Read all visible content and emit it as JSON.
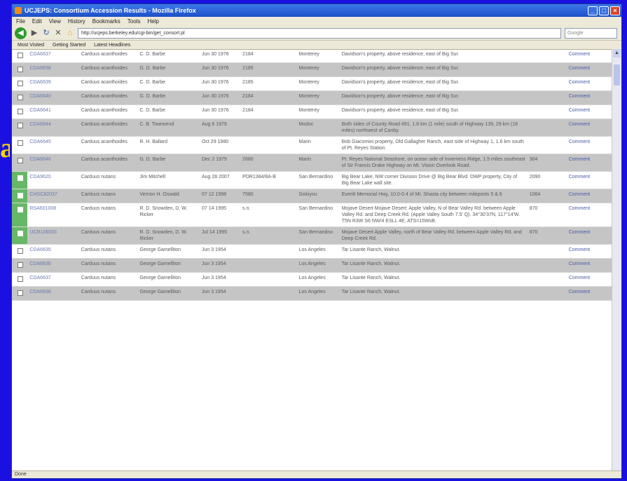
{
  "window": {
    "title": "UCJEPS: Consortium Accession Results - Mozilla Firefox"
  },
  "menu": [
    "File",
    "Edit",
    "View",
    "History",
    "Bookmarks",
    "Tools",
    "Help"
  ],
  "address": {
    "url": "http://ucjeps.berkeley.edu/cgi-bin/get_consort.pl"
  },
  "search": {
    "placeholder": "Google"
  },
  "bookmarks": [
    "Most Visited",
    "Getting Started",
    "Latest Headlines"
  ],
  "rows": [
    {
      "acc": "CDA6637",
      "taxon": "Carduus acanthoides",
      "coll": "C. D. Barbe",
      "date": "Jun 30 1976",
      "num": "2184",
      "county": "Monterey",
      "loc": "Davidson's property, above residence, east of Big Sur.",
      "elev": "",
      "sel": false,
      "alt": false
    },
    {
      "acc": "CDA6638",
      "taxon": "Carduus acanthoides",
      "coll": "G. D. Barbe",
      "date": "Jun 30 1976",
      "num": "2185",
      "county": "Monterey",
      "loc": "Davidson's property, above residence, east of Big Sur.",
      "elev": "",
      "sel": false,
      "alt": true
    },
    {
      "acc": "CDA6639",
      "taxon": "Carduus acanthoides",
      "coll": "C. D. Barbe",
      "date": "Jun 30 1976",
      "num": "2185",
      "county": "Monterey",
      "loc": "Davidson's property, above residence, east of Big Sur.",
      "elev": "",
      "sel": false,
      "alt": false
    },
    {
      "acc": "CDA6640",
      "taxon": "Carduus acanthoides",
      "coll": "G. D. Barbe",
      "date": "Jun 30 1976",
      "num": "2184",
      "county": "Monterey",
      "loc": "Davidson's property, above residence, east of Big Sur.",
      "elev": "",
      "sel": false,
      "alt": true
    },
    {
      "acc": "CDA6641",
      "taxon": "Carduus acanthoides",
      "coll": "C. D. Barbe",
      "date": "Jun 30 1976",
      "num": "2184",
      "county": "Monterey",
      "loc": "Davidson's property, above residence, east of Big Sur.",
      "elev": "",
      "sel": false,
      "alt": false
    },
    {
      "acc": "CDA6644",
      "taxon": "Carduus acanthoides",
      "coll": "C. B. Townsend",
      "date": "Aug 6 1979",
      "num": "",
      "county": "Modoc",
      "loc": "Both sides of County Road #91, 1.6 km (1 mile) south of Highway 139, 29 km (18 miles) northwest of Canby.",
      "elev": "",
      "sel": false,
      "alt": true
    },
    {
      "acc": "CDA6645",
      "taxon": "Carduus acanthoides",
      "coll": "R. H. Ballard",
      "date": "Oct 29 1980",
      "num": "",
      "county": "Marin",
      "loc": "Bob Giacomini property, Old Gallagher Ranch, east side of Highway 1, 1.6 km south of Pt. Reyes Station.",
      "elev": "",
      "sel": false,
      "alt": false
    },
    {
      "acc": "CDA6646",
      "taxon": "Carduus acanthoides",
      "coll": "G. D. Barbe",
      "date": "Dec 2 1979",
      "num": "2680",
      "county": "Marin",
      "loc": "Pt. Reyes National Seashore, on ocean side of Inverness Ridge, 1.5 miles southeast of Sir Francis Drake Highway on Mt. Vision Overlook Road.",
      "elev": "304",
      "sel": false,
      "alt": true
    },
    {
      "acc": "CDA9620",
      "taxon": "Carduus nutans",
      "coll": "Jim Mitchell",
      "date": "Aug 28 2007",
      "num": "PDR1384/8A-B",
      "county": "San Bernardino",
      "loc": "Big Bear Lake, NW corner Division Drive @ Big Bear Blvd. DWP property, City of Big Bear Lake wall site.",
      "elev": "2090",
      "sel": true,
      "alt": false
    },
    {
      "acc": "CHSC82037",
      "taxon": "Carduus nutans",
      "coll": "Vernon H. Oswald",
      "date": "07 12 1998",
      "num": "7580",
      "county": "Siskiyou",
      "loc": "Everitt Memorial Hwy, 10.0-0.4 of Mt. Shasta city between mileposts 5 & 6",
      "elev": "1064",
      "sel": true,
      "alt": true
    },
    {
      "acc": "RSA601008",
      "taxon": "Carduus nutans",
      "coll": "R. D. Snowden, D. W. Ricker",
      "date": "07 14 1995",
      "num": "s.n.",
      "county": "San Bernardino",
      "loc": "Mojave Desert Mojave Desert: Apple Valley, N of Bear Valley Rd. between Apple Valley Rd. and Deep Creek Rd. (Apple Valley South 7.5' Q). 34°30'37N, 117°14'W. T5N R3W S6 NW/4 ESLL 4E, ATS=15WsB.",
      "elev": "870",
      "sel": true,
      "alt": false
    },
    {
      "acc": "UCR106033",
      "taxon": "Carduus nutans",
      "coll": "R. D. Snowden, D. W. Ricker",
      "date": "Jul 14 1995",
      "num": "s.n.",
      "county": "San Bernardino",
      "loc": "Mojave Desert Apple Valley, north of Bear Valley Rd. between Apple Valley Rd. and Deep Creek Rd.",
      "elev": "870",
      "sel": true,
      "alt": true
    },
    {
      "acc": "CDA6635",
      "taxon": "Carduus nutans",
      "coll": "George Gamelliton",
      "date": "Jun 3 1954",
      "num": "",
      "county": "Los Angeles",
      "loc": "Tar Lisante Ranch, Walnut.",
      "elev": "",
      "sel": false,
      "alt": false
    },
    {
      "acc": "CDA6636",
      "taxon": "Carduus nutans",
      "coll": "George Gamelliton",
      "date": "Jun 3 1954",
      "num": "",
      "county": "Los Angeles",
      "loc": "Tar Lisante Ranch, Walnut.",
      "elev": "",
      "sel": false,
      "alt": true
    },
    {
      "acc": "CDA6637",
      "taxon": "Carduus nutans",
      "coll": "George Gamelliton",
      "date": "Jun 3 1954",
      "num": "",
      "county": "Los Angeles",
      "loc": "Tar Lisante Ranch, Walnut.",
      "elev": "",
      "sel": false,
      "alt": false
    },
    {
      "acc": "CDA6638",
      "taxon": "Carduus nutans",
      "coll": "George Gamelliton",
      "date": "Jun 3 1954",
      "num": "",
      "county": "Los Angeles",
      "loc": "Tar Lisante Ranch, Walnut.",
      "elev": "",
      "sel": false,
      "alt": true
    }
  ],
  "comment_label": "Comment",
  "status": "Done",
  "colors": {
    "desktop": "#1a10e0",
    "selected": "#66b866",
    "alt_row": "#c5c5c5"
  }
}
